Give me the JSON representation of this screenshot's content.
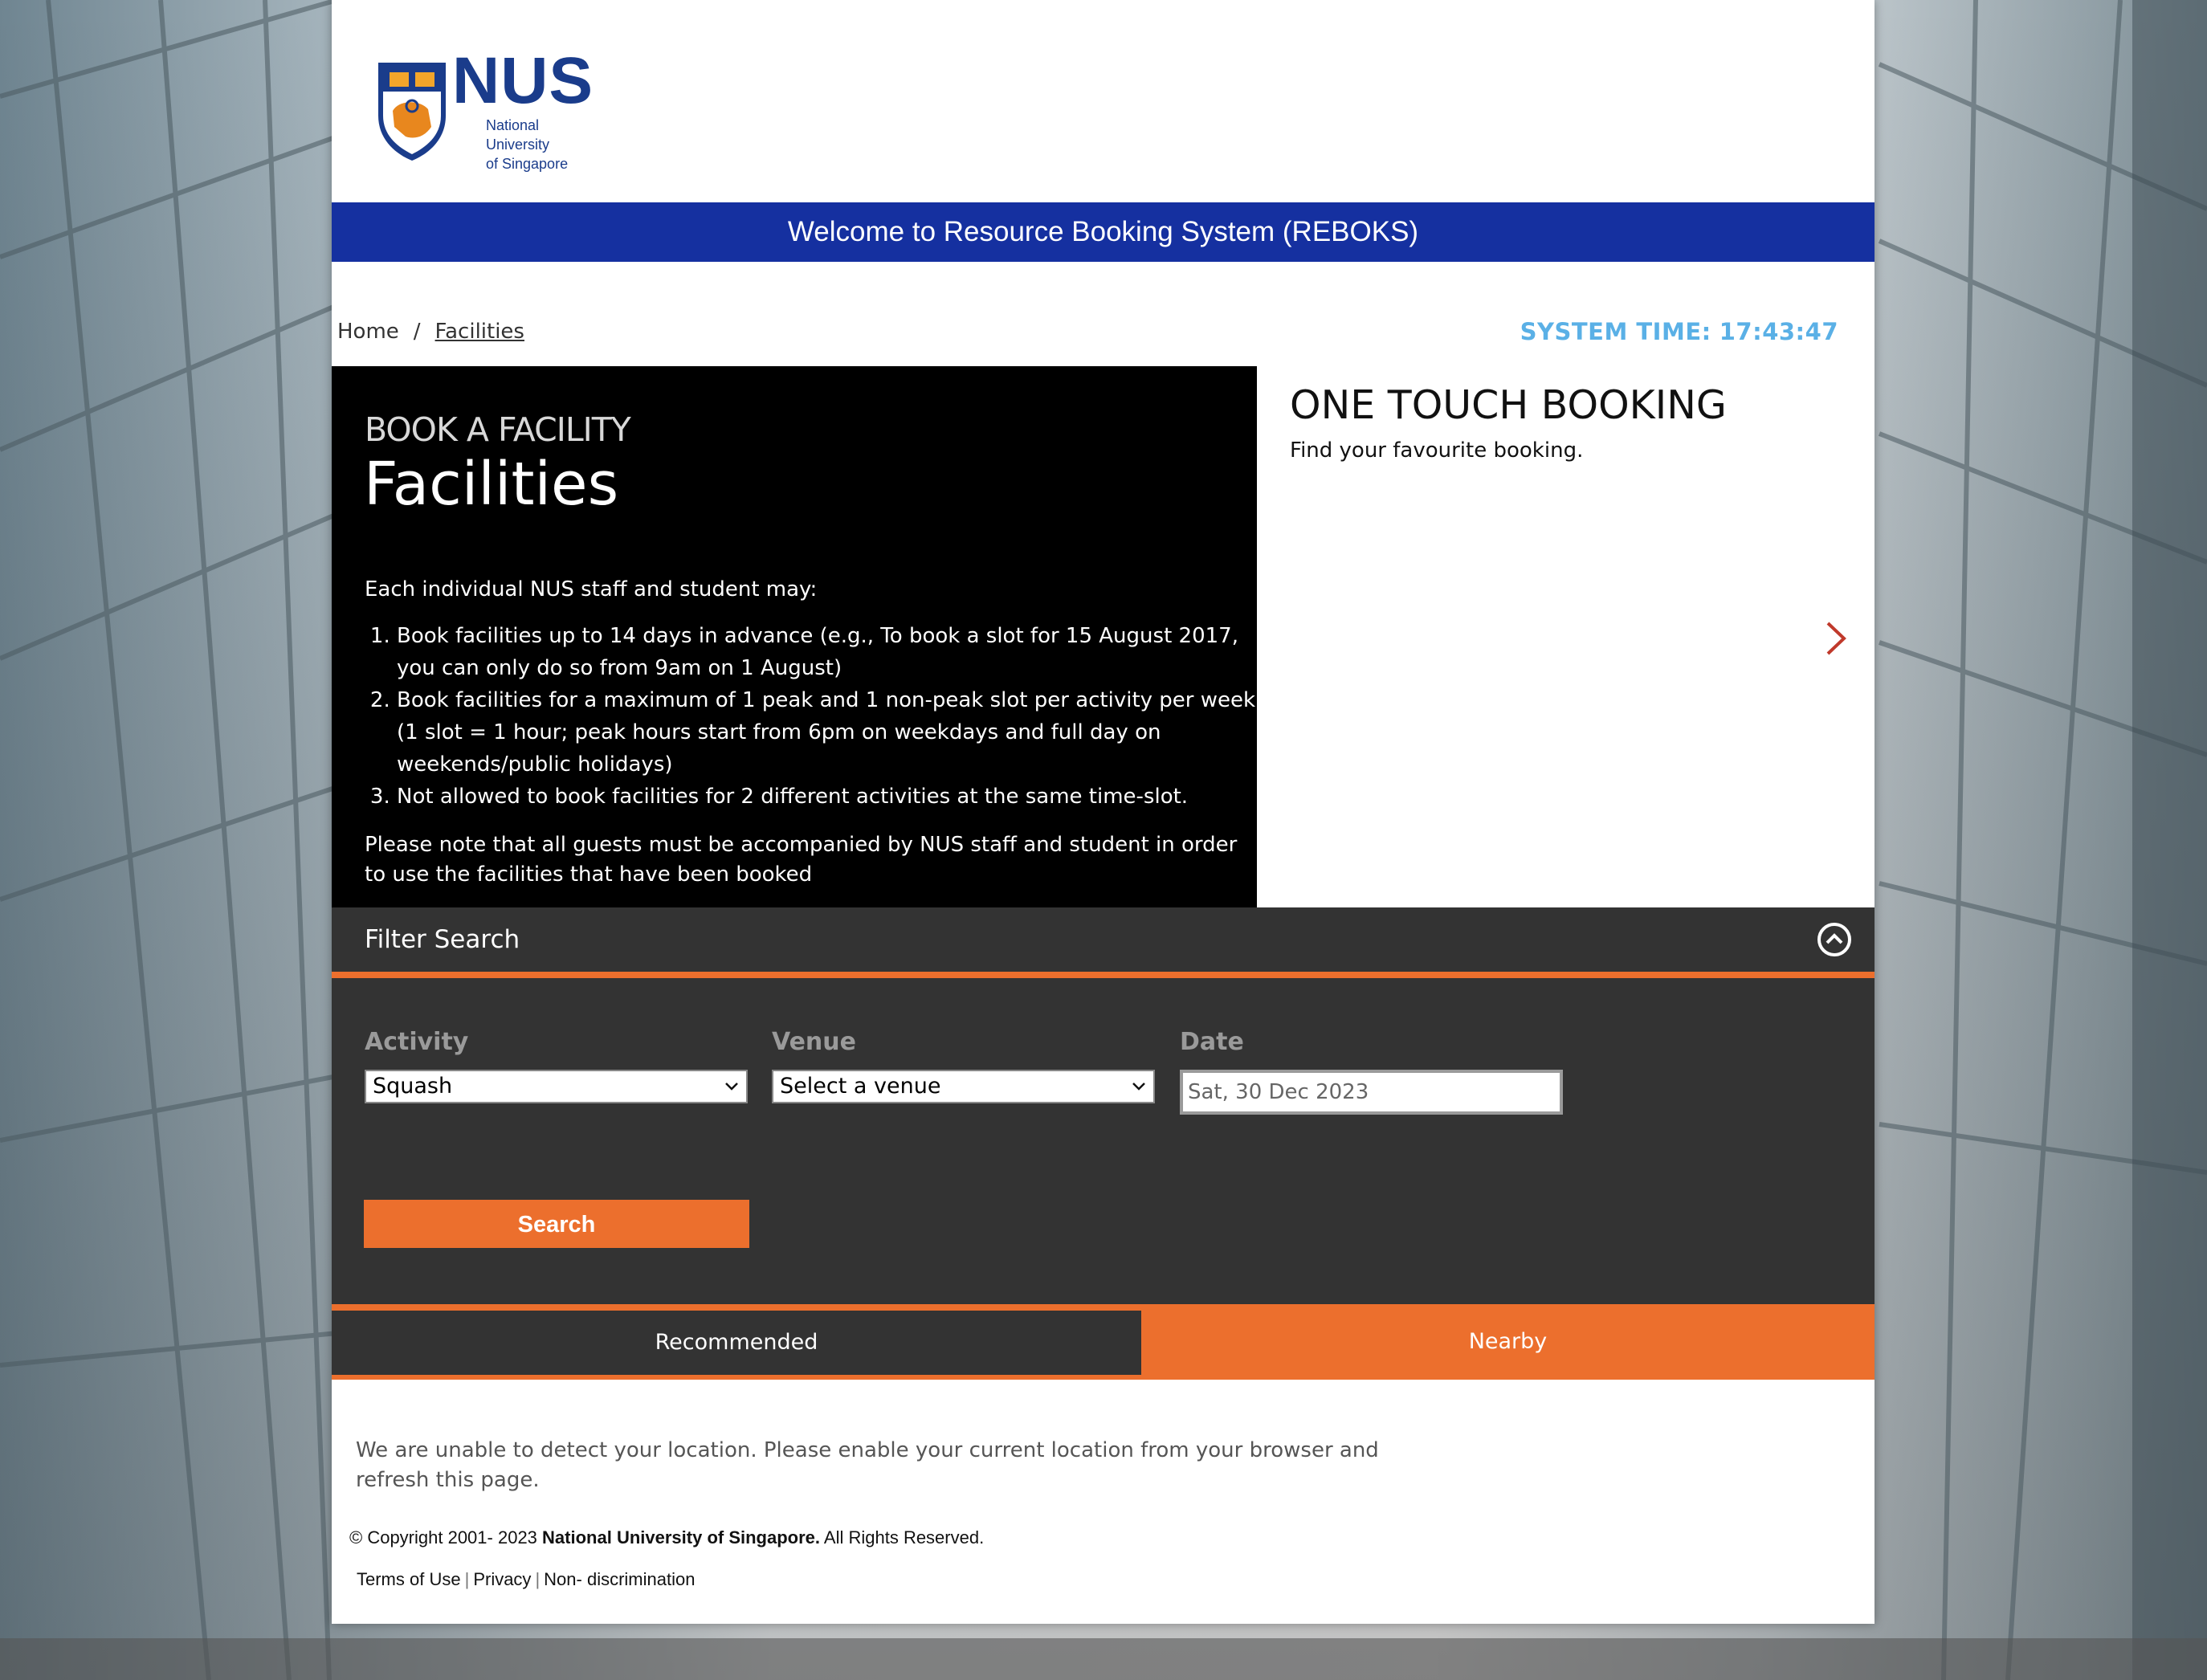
{
  "logo": {
    "acronym": "NUS",
    "line1": "National University",
    "line2": "of Singapore"
  },
  "banner": {
    "text": "Welcome to Resource Booking System (REBOKS)"
  },
  "breadcrumb": {
    "home": "Home",
    "separator": "/",
    "current": "Facilities"
  },
  "system_time": {
    "label": "SYSTEM TIME:",
    "value": "17:43:47"
  },
  "info": {
    "kicker": "BOOK A FACILITY",
    "title": "Facilities",
    "intro": "Each individual NUS staff and student may:",
    "rules": [
      "Book facilities up to 14 days in advance (e.g., To book a slot for 15 August 2017, you can only do so from 9am on 1 August)",
      "Book facilities for a maximum of 1 peak and 1 non-peak slot per activity per week (1 slot = 1 hour; peak hours start from 6pm on weekdays and full day on weekends/public holidays)",
      "Not allowed to book facilities for 2 different activities at the same time-slot."
    ],
    "note": "Please note that all guests must be accompanied by NUS staff and student in order to use the facilities that have been booked"
  },
  "one_touch": {
    "title": "ONE TOUCH BOOKING",
    "subtitle": "Find your favourite booking.",
    "next_icon": "chevron-right-icon"
  },
  "filter": {
    "heading": "Filter Search",
    "collapse_icon": "chevron-up-circle-icon",
    "activity_label": "Activity",
    "activity_value": "Squash",
    "venue_label": "Venue",
    "venue_value": "Select a venue",
    "date_label": "Date",
    "date_value": "Sat, 30 Dec 2023",
    "search_label": "Search"
  },
  "tabs": {
    "recommended": "Recommended",
    "nearby": "Nearby"
  },
  "location_message": "We are unable to detect your location. Please enable your current location from your browser and refresh this page.",
  "footer": {
    "copyright_prefix": "© Copyright 2001- 2023",
    "copyright_org": "National University of Singapore.",
    "copyright_suffix": "All Rights Reserved.",
    "links": [
      "Terms of Use",
      "Privacy",
      "Non- discrimination"
    ]
  },
  "colors": {
    "brand_blue": "#1530a0",
    "accent_orange": "#ec6f2d",
    "panel_dark": "#333333",
    "time_blue": "#5ab0e6"
  }
}
